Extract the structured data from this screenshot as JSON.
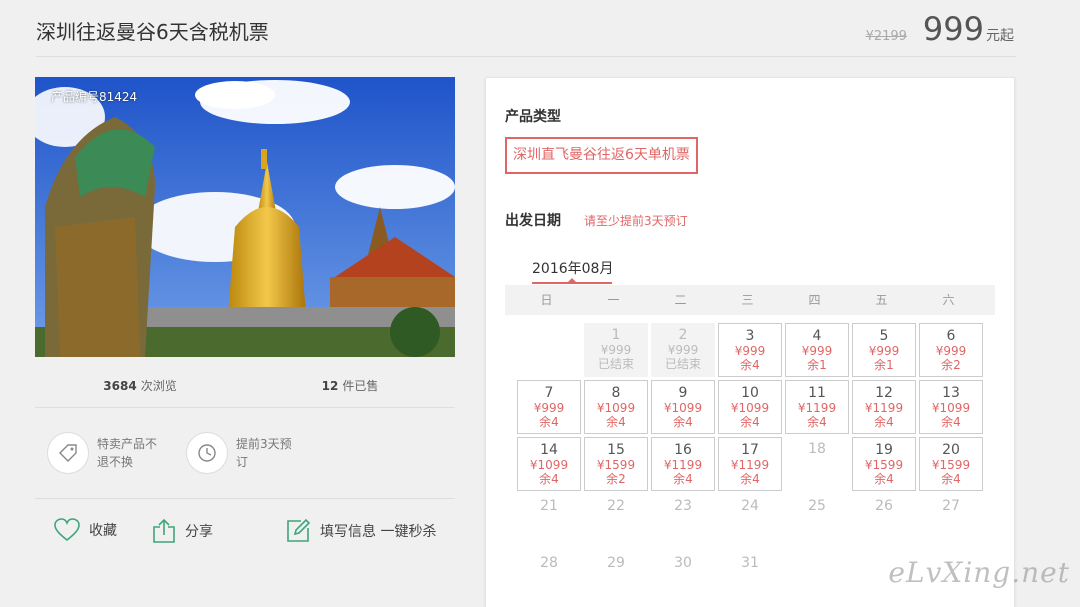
{
  "header": {
    "title": "深圳往返曼谷6天含税机票",
    "price_old": "¥2199",
    "price_now": "999",
    "price_unit": "元起"
  },
  "product": {
    "number_label": "产品编号81424",
    "views_count": "3684",
    "views_label": "次浏览",
    "sold_count": "12",
    "sold_label": "件已售"
  },
  "features": [
    {
      "icon": "tag-icon",
      "text": "特卖产品不退不换"
    },
    {
      "icon": "clock-icon",
      "text": "提前3天预订"
    }
  ],
  "actions": {
    "favorite": "收藏",
    "share": "分享",
    "fill_info": "填写信息 一键秒杀"
  },
  "booking": {
    "type_label": "产品类型",
    "type_option": "深圳直飞曼谷往返6天单机票",
    "date_label": "出发日期",
    "date_hint": "请至少提前3天预订",
    "month": "2016年08月",
    "weekdays": [
      "日",
      "一",
      "二",
      "三",
      "四",
      "五",
      "六"
    ]
  },
  "calendar": [
    {
      "d": "1",
      "p": "¥999",
      "s": "已结束",
      "state": "ended",
      "r": 0,
      "c": 1
    },
    {
      "d": "2",
      "p": "¥999",
      "s": "已结束",
      "state": "ended",
      "r": 0,
      "c": 2
    },
    {
      "d": "3",
      "p": "¥999",
      "s": "余4",
      "state": "avail",
      "r": 0,
      "c": 3
    },
    {
      "d": "4",
      "p": "¥999",
      "s": "余1",
      "state": "avail",
      "r": 0,
      "c": 4
    },
    {
      "d": "5",
      "p": "¥999",
      "s": "余1",
      "state": "avail",
      "r": 0,
      "c": 5
    },
    {
      "d": "6",
      "p": "¥999",
      "s": "余2",
      "state": "avail",
      "r": 0,
      "c": 6
    },
    {
      "d": "7",
      "p": "¥999",
      "s": "余4",
      "state": "avail",
      "r": 1,
      "c": 0
    },
    {
      "d": "8",
      "p": "¥1099",
      "s": "余4",
      "state": "avail",
      "r": 1,
      "c": 1
    },
    {
      "d": "9",
      "p": "¥1099",
      "s": "余4",
      "state": "avail",
      "r": 1,
      "c": 2
    },
    {
      "d": "10",
      "p": "¥1099",
      "s": "余4",
      "state": "avail",
      "r": 1,
      "c": 3
    },
    {
      "d": "11",
      "p": "¥1199",
      "s": "余4",
      "state": "avail",
      "r": 1,
      "c": 4
    },
    {
      "d": "12",
      "p": "¥1199",
      "s": "余4",
      "state": "avail",
      "r": 1,
      "c": 5
    },
    {
      "d": "13",
      "p": "¥1099",
      "s": "余4",
      "state": "avail",
      "r": 1,
      "c": 6
    },
    {
      "d": "14",
      "p": "¥1099",
      "s": "余4",
      "state": "avail",
      "r": 2,
      "c": 0
    },
    {
      "d": "15",
      "p": "¥1599",
      "s": "余2",
      "state": "avail",
      "r": 2,
      "c": 1
    },
    {
      "d": "16",
      "p": "¥1199",
      "s": "余4",
      "state": "avail",
      "r": 2,
      "c": 2
    },
    {
      "d": "17",
      "p": "¥1199",
      "s": "余4",
      "state": "avail",
      "r": 2,
      "c": 3
    },
    {
      "d": "18",
      "p": "",
      "s": "",
      "state": "none",
      "r": 2,
      "c": 4
    },
    {
      "d": "19",
      "p": "¥1599",
      "s": "余4",
      "state": "avail",
      "r": 2,
      "c": 5
    },
    {
      "d": "20",
      "p": "¥1599",
      "s": "余4",
      "state": "avail",
      "r": 2,
      "c": 6
    },
    {
      "d": "21",
      "p": "",
      "s": "",
      "state": "none",
      "r": 3,
      "c": 0
    },
    {
      "d": "22",
      "p": "",
      "s": "",
      "state": "none",
      "r": 3,
      "c": 1
    },
    {
      "d": "23",
      "p": "",
      "s": "",
      "state": "none",
      "r": 3,
      "c": 2
    },
    {
      "d": "24",
      "p": "",
      "s": "",
      "state": "none",
      "r": 3,
      "c": 3
    },
    {
      "d": "25",
      "p": "",
      "s": "",
      "state": "none",
      "r": 3,
      "c": 4
    },
    {
      "d": "26",
      "p": "",
      "s": "",
      "state": "none",
      "r": 3,
      "c": 5
    },
    {
      "d": "27",
      "p": "",
      "s": "",
      "state": "none",
      "r": 3,
      "c": 6
    },
    {
      "d": "28",
      "p": "",
      "s": "",
      "state": "none",
      "r": 4,
      "c": 0
    },
    {
      "d": "29",
      "p": "",
      "s": "",
      "state": "none",
      "r": 4,
      "c": 1
    },
    {
      "d": "30",
      "p": "",
      "s": "",
      "state": "none",
      "r": 4,
      "c": 2
    },
    {
      "d": "31",
      "p": "",
      "s": "",
      "state": "none",
      "r": 4,
      "c": 3
    }
  ],
  "watermark": "eLvXing.net",
  "colors": {
    "accent": "#e06666",
    "icon_green": "#3fa57a"
  }
}
